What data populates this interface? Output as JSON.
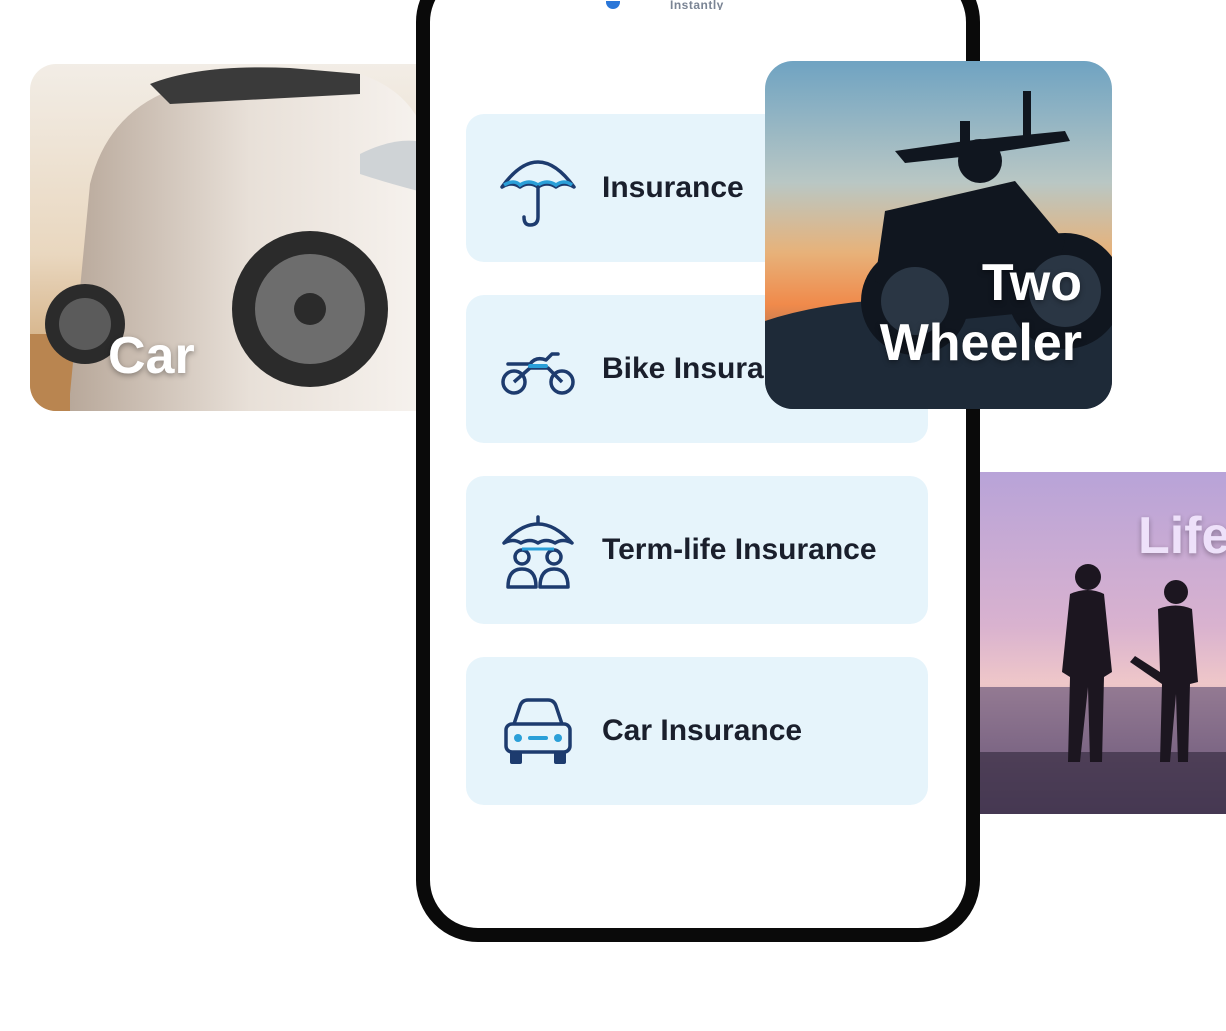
{
  "phone": {
    "top_text": "Instantly"
  },
  "insurance_list": [
    {
      "label": "Insurance",
      "icon": "umbrella-icon"
    },
    {
      "label": "Bike Insura",
      "icon": "motorcycle-icon"
    },
    {
      "label": "Term-life Insurance",
      "icon": "family-umbrella-icon"
    },
    {
      "label": "Car Insurance",
      "icon": "car-icon"
    }
  ],
  "photo_cards": {
    "car": {
      "caption": "Car"
    },
    "two_wheeler": {
      "caption_line1": "Two",
      "caption_line2": "Wheeler"
    },
    "life": {
      "caption": "Life"
    }
  },
  "colors": {
    "card_background": "#e6f4fb",
    "icon_dark": "#1d3b6e",
    "icon_accent": "#2a9fd8",
    "phone_frame": "#0a0a0a"
  }
}
